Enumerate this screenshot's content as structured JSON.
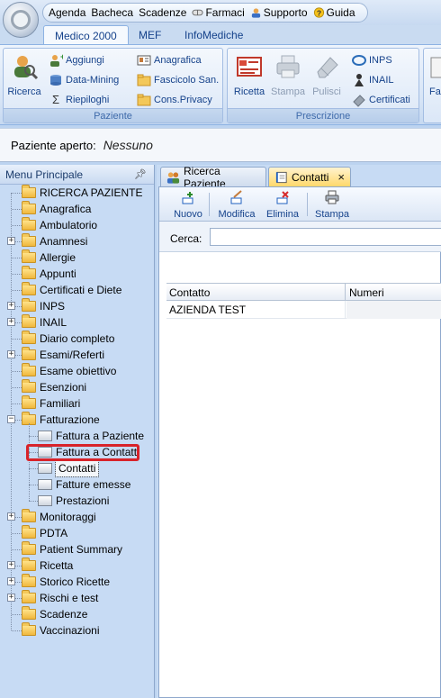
{
  "quick_menu": {
    "items": [
      {
        "label": "Agenda",
        "icon": ""
      },
      {
        "label": "Bacheca",
        "icon": ""
      },
      {
        "label": "Scadenze",
        "icon": ""
      },
      {
        "label": "Farmaci",
        "icon": "pill-icon"
      },
      {
        "label": "Supporto",
        "icon": "person-icon"
      },
      {
        "label": "Guida",
        "icon": "help-icon"
      }
    ]
  },
  "ribbon": {
    "tabs": [
      "Medico 2000",
      "MEF",
      "InfoMediche"
    ],
    "active_tab": "Medico 2000",
    "groups": {
      "paziente": {
        "label": "Paziente",
        "ricerca": "Ricerca",
        "aggiungi": "Aggiungi",
        "data_mining": "Data-Mining",
        "riepiloghi": "Riepiloghi",
        "anagrafica": "Anagrafica",
        "fascicolo": "Fascicolo San.",
        "privacy": "Cons.Privacy"
      },
      "prescrizione": {
        "label": "Prescrizione",
        "ricetta": "Ricetta",
        "stampa": "Stampa",
        "pulisci": "Pulisci",
        "inps": "INPS",
        "inail": "INAIL",
        "certificati": "Certificati"
      },
      "extra": {
        "label_partial": "Fa"
      }
    }
  },
  "patient_bar": {
    "label": "Paziente aperto:",
    "value": "Nessuno"
  },
  "menu": {
    "title": "Menu Principale",
    "pin": "ᵖ",
    "items": [
      {
        "label": "RICERCA PAZIENTE",
        "expander": ""
      },
      {
        "label": "Anagrafica",
        "expander": ""
      },
      {
        "label": "Ambulatorio",
        "expander": ""
      },
      {
        "label": "Anamnesi",
        "expander": "+"
      },
      {
        "label": "Allergie",
        "expander": ""
      },
      {
        "label": "Appunti",
        "expander": ""
      },
      {
        "label": "Certificati e Diete",
        "expander": ""
      },
      {
        "label": "INPS",
        "expander": "+"
      },
      {
        "label": "INAIL",
        "expander": "+"
      },
      {
        "label": "Diario completo",
        "expander": ""
      },
      {
        "label": "Esami/Referti",
        "expander": "+"
      },
      {
        "label": "Esame obiettivo",
        "expander": ""
      },
      {
        "label": "Esenzioni",
        "expander": ""
      },
      {
        "label": "Familiari",
        "expander": ""
      },
      {
        "label": "Fatturazione",
        "expander": "−"
      },
      {
        "label": "Fattura a Paziente",
        "expander": "",
        "child": true
      },
      {
        "label": "Fattura a Contatt",
        "expander": "",
        "child": true
      },
      {
        "label": "Contatti",
        "expander": "",
        "child": true,
        "selected": true
      },
      {
        "label": "Fatture emesse",
        "expander": "",
        "child": true
      },
      {
        "label": "Prestazioni",
        "expander": "",
        "child": true
      },
      {
        "label": "Monitoraggi",
        "expander": "+"
      },
      {
        "label": "PDTA",
        "expander": ""
      },
      {
        "label": "Patient Summary",
        "expander": ""
      },
      {
        "label": "Ricetta",
        "expander": "+"
      },
      {
        "label": "Storico Ricette",
        "expander": "+"
      },
      {
        "label": "Rischi e test",
        "expander": "+"
      },
      {
        "label": "Scadenze",
        "expander": ""
      },
      {
        "label": "Vaccinazioni",
        "expander": ""
      }
    ]
  },
  "doc_tabs": [
    {
      "label": "Ricerca Paziente",
      "icon": "people-icon",
      "active": false
    },
    {
      "label": "Contatti",
      "icon": "notebook-icon",
      "active": true,
      "close": "×"
    }
  ],
  "toolbar": {
    "nuovo": "Nuovo",
    "modifica": "Modifica",
    "elimina": "Elimina",
    "stampa": "Stampa"
  },
  "search": {
    "label": "Cerca:",
    "value": ""
  },
  "grid": {
    "columns": [
      "Contatto",
      "Numeri"
    ],
    "rows": [
      [
        "AZIENDA TEST",
        ""
      ]
    ]
  }
}
